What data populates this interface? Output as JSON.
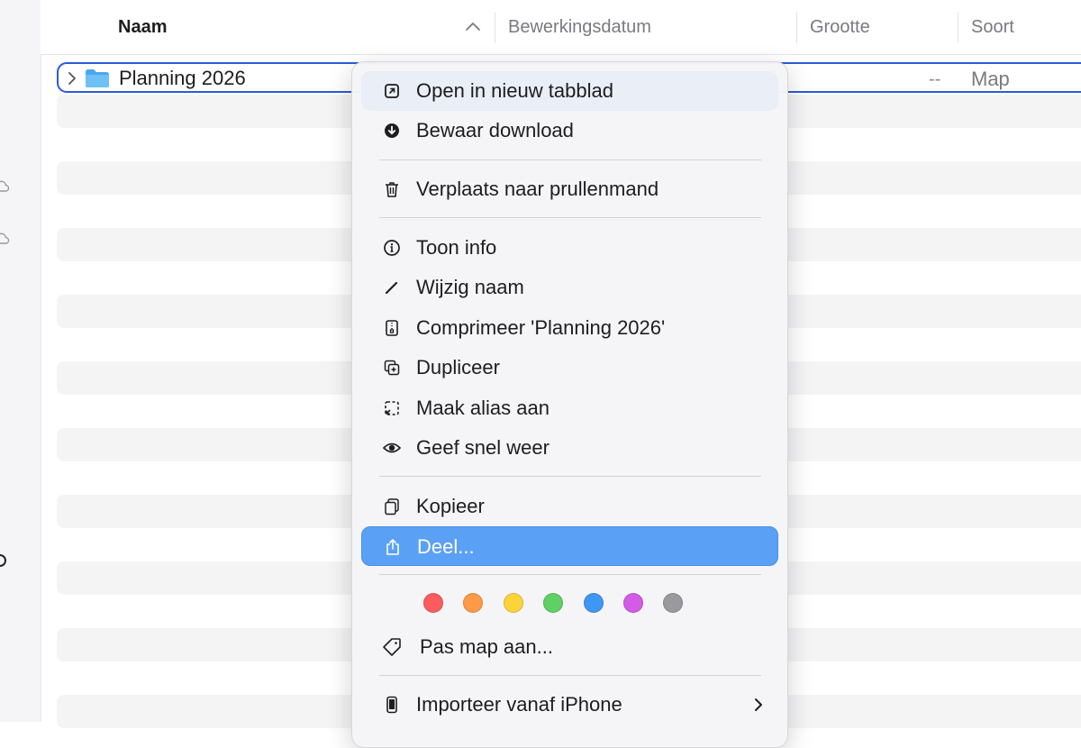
{
  "columns": {
    "name": "Naam",
    "modified": "Bewerkingsdatum",
    "size": "Grootte",
    "kind": "Soort"
  },
  "selected_row": {
    "name": "Planning 2026",
    "size": "--",
    "kind": "Map"
  },
  "context_menu": {
    "open_new_tab": "Open in nieuw tabblad",
    "keep_download": "Bewaar download",
    "move_to_trash": "Verplaats naar prullenmand",
    "get_info": "Toon info",
    "rename": "Wijzig naam",
    "compress": "Comprimeer 'Planning 2026'",
    "duplicate": "Dupliceer",
    "make_alias": "Maak alias aan",
    "quick_look": "Geef snel weer",
    "copy": "Kopieer",
    "share": "Deel...",
    "customize_folder": "Pas map aan...",
    "import_iphone": "Importeer vanaf iPhone"
  },
  "tags": [
    {
      "name": "red",
      "color": "#fd5c5e"
    },
    {
      "name": "orange",
      "color": "#fd9a47"
    },
    {
      "name": "yellow",
      "color": "#fdd33a"
    },
    {
      "name": "green",
      "color": "#5fcf66"
    },
    {
      "name": "blue",
      "color": "#3f97f5"
    },
    {
      "name": "purple",
      "color": "#d35be5"
    },
    {
      "name": "gray",
      "color": "#9a9a9e"
    }
  ],
  "colors": {
    "selection_border": "#2a5cd6",
    "highlight": "#5aa0f5",
    "folder": "#5ab4f0"
  }
}
